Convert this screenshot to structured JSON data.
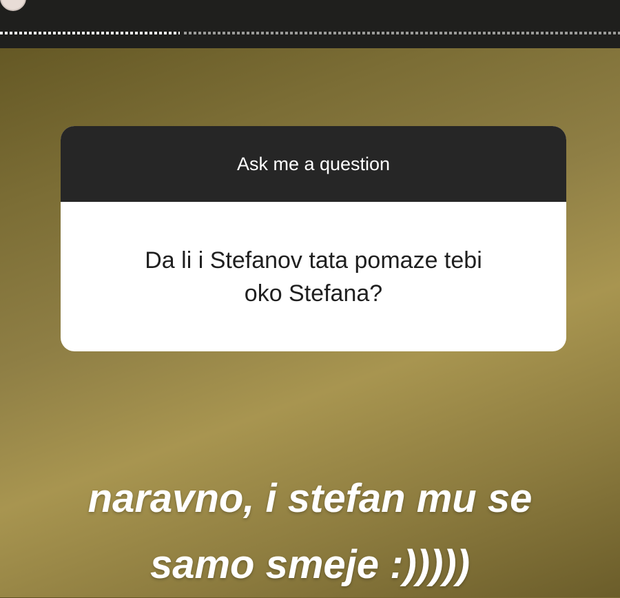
{
  "story": {
    "progress_fraction": 0.29
  },
  "question_card": {
    "header": "Ask me a question",
    "question": "Da li i Stefanov tata pomaze tebi oko Stefana?"
  },
  "reply": {
    "line1": "naravno, i stefan mu se",
    "line2": "samo smeje :)))))"
  }
}
